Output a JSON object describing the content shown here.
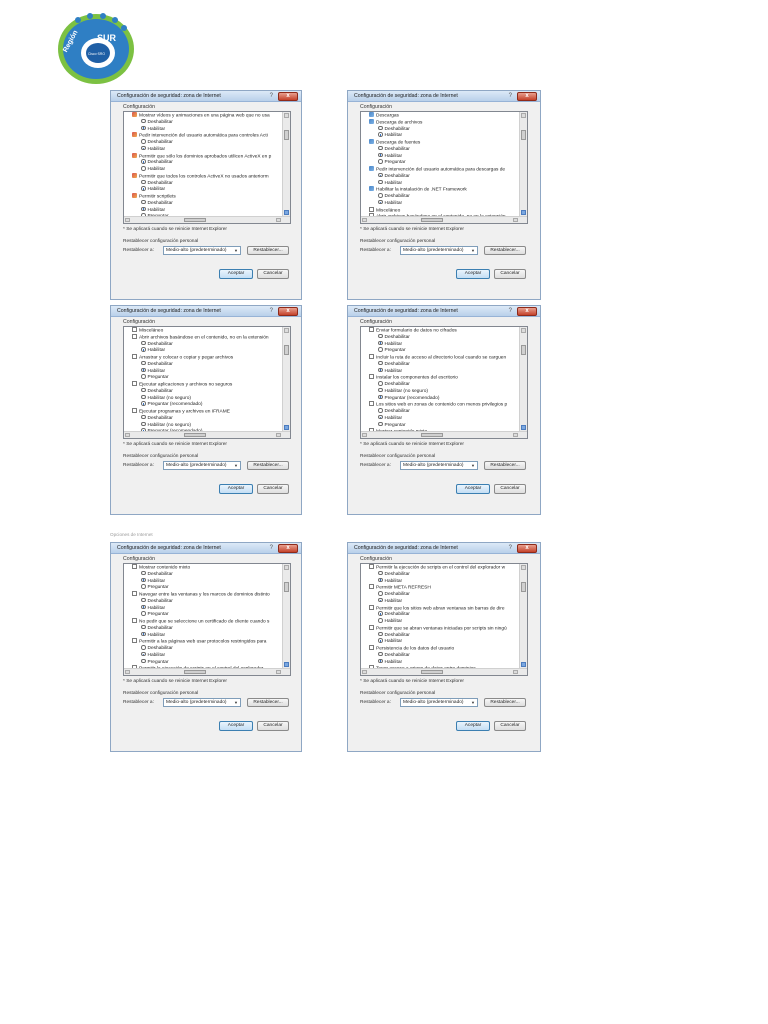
{
  "logo": {
    "text_region": "Región",
    "text_sur": "SUR",
    "text_cisco": "Cisco·SRO",
    "colors": {
      "ring": "#2f7fc4",
      "rim": "#7cc142",
      "center": "#ffffff",
      "inner": "#1f5fa5"
    }
  },
  "common": {
    "question": "?",
    "close": "x",
    "config_label": "Configuración",
    "note": "* Se aplicará cuando se reinicie Internet Explorer",
    "reset_label": "Restablecer configuración personal",
    "reset_to": "Restablecer a:",
    "reset_button": "Restablecer...",
    "ok": "Aceptar",
    "cancel": "Cancelar",
    "dropdown_arrow": "▼"
  },
  "ghost_caption": "Opciones de Internet",
  "dialogs": [
    {
      "title": "Configuración de seguridad: zona de Internet",
      "select": "Medio-alto (predeterminado)",
      "items": [
        {
          "kind": "sec",
          "level": "p",
          "text": "Mostrar vídeos y animaciones en una página web que no usa"
        },
        {
          "kind": "radio",
          "level": "s",
          "on": false,
          "text": "Deshabilitar"
        },
        {
          "kind": "radio",
          "level": "s",
          "on": true,
          "text": "Habilitar"
        },
        {
          "kind": "sec",
          "level": "p",
          "text": "Pedir intervención del usuario automática para controles Acti"
        },
        {
          "kind": "radio",
          "level": "s",
          "on": false,
          "text": "Deshabilitar"
        },
        {
          "kind": "radio",
          "level": "s",
          "on": true,
          "text": "Habilitar"
        },
        {
          "kind": "sec",
          "level": "p",
          "text": "Permitir que sólo los dominios aprobados utilicen ActiveX en p"
        },
        {
          "kind": "radio",
          "level": "s",
          "on": true,
          "text": "Deshabilitar"
        },
        {
          "kind": "radio",
          "level": "s",
          "on": false,
          "text": "Habilitar"
        },
        {
          "kind": "sec",
          "level": "p",
          "text": "Permitir que todos los controles ActiveX no usados anteriorm"
        },
        {
          "kind": "radio",
          "level": "s",
          "on": false,
          "text": "Deshabilitar"
        },
        {
          "kind": "radio",
          "level": "s",
          "on": true,
          "text": "Habilitar"
        },
        {
          "kind": "sec",
          "level": "p",
          "text": "Permitir scriptlets"
        },
        {
          "kind": "radio",
          "level": "s",
          "on": false,
          "text": "Deshabilitar"
        },
        {
          "kind": "radio",
          "level": "s",
          "on": true,
          "text": "Habilitar"
        },
        {
          "kind": "radio",
          "level": "s",
          "on": false,
          "text": "Preguntar"
        }
      ]
    },
    {
      "title": "Configuración de seguridad: zona de Internet",
      "select": "Medio-alto (predeterminado)",
      "items": [
        {
          "kind": "folder",
          "level": "p",
          "text": "Descargas"
        },
        {
          "kind": "folder",
          "level": "p",
          "text": "Descarga de archivos"
        },
        {
          "kind": "radio",
          "level": "s",
          "on": false,
          "text": "Deshabilitar"
        },
        {
          "kind": "radio",
          "level": "s",
          "on": true,
          "text": "Habilitar"
        },
        {
          "kind": "folder",
          "level": "p",
          "text": "Descarga de fuentes"
        },
        {
          "kind": "radio",
          "level": "s",
          "on": false,
          "text": "Deshabilitar"
        },
        {
          "kind": "radio",
          "level": "s",
          "on": true,
          "text": "Habilitar"
        },
        {
          "kind": "radio",
          "level": "s",
          "on": false,
          "text": "Preguntar"
        },
        {
          "kind": "folder",
          "level": "p",
          "text": "Pedir intervención del usuario automática para descargas de"
        },
        {
          "kind": "radio",
          "level": "s",
          "on": true,
          "text": "Deshabilitar"
        },
        {
          "kind": "radio",
          "level": "s",
          "on": false,
          "text": "Habilitar"
        },
        {
          "kind": "folder",
          "level": "p",
          "text": "Habilitar la instalación de .NET Framework"
        },
        {
          "kind": "radio",
          "level": "s",
          "on": false,
          "text": "Deshabilitar"
        },
        {
          "kind": "radio",
          "level": "s",
          "on": true,
          "text": "Habilitar"
        },
        {
          "kind": "box",
          "level": "p",
          "text": "Misceláneo"
        },
        {
          "kind": "box",
          "level": "p",
          "text": "Abrir archivos basándose en el contenido, no en la extensión"
        }
      ]
    },
    {
      "title": "Configuración de seguridad: zona de Internet",
      "select": "Medio-alto (predeterminado)",
      "items": [
        {
          "kind": "box",
          "level": "p",
          "text": "Misceláneo"
        },
        {
          "kind": "box",
          "level": "p",
          "text": "Abrir archivos basándose en el contenido, no en la extensión"
        },
        {
          "kind": "radio",
          "level": "s",
          "on": false,
          "text": "Deshabilitar"
        },
        {
          "kind": "radio",
          "level": "s",
          "on": true,
          "text": "Habilitar"
        },
        {
          "kind": "box",
          "level": "p",
          "text": "Arrastrar y colocar o copiar y pegar archivos"
        },
        {
          "kind": "radio",
          "level": "s",
          "on": false,
          "text": "Deshabilitar"
        },
        {
          "kind": "radio",
          "level": "s",
          "on": true,
          "text": "Habilitar"
        },
        {
          "kind": "radio",
          "level": "s",
          "on": false,
          "text": "Preguntar"
        },
        {
          "kind": "box",
          "level": "p",
          "text": "Ejecutar aplicaciones y archivos no seguros"
        },
        {
          "kind": "radio",
          "level": "s",
          "on": false,
          "text": "Deshabilitar"
        },
        {
          "kind": "radio",
          "level": "s",
          "on": false,
          "text": "Habilitar (no seguro)"
        },
        {
          "kind": "radio",
          "level": "s",
          "on": true,
          "text": "Preguntar (recomendado)"
        },
        {
          "kind": "box",
          "level": "p",
          "text": "Ejecutar programas y archivos en IFRAME"
        },
        {
          "kind": "radio",
          "level": "s",
          "on": false,
          "text": "Deshabilitar"
        },
        {
          "kind": "radio",
          "level": "s",
          "on": false,
          "text": "Habilitar (no seguro)"
        },
        {
          "kind": "radio",
          "level": "s",
          "on": true,
          "text": "Preguntar (recomendado)"
        }
      ]
    },
    {
      "title": "Configuración de seguridad: zona de Internet",
      "select": "Medio-alto (predeterminado)",
      "items": [
        {
          "kind": "box",
          "level": "p",
          "text": "Enviar formulario de datos no cifrados"
        },
        {
          "kind": "radio",
          "level": "s",
          "on": false,
          "text": "Deshabilitar"
        },
        {
          "kind": "radio",
          "level": "s",
          "on": true,
          "text": "Habilitar"
        },
        {
          "kind": "radio",
          "level": "s",
          "on": false,
          "text": "Preguntar"
        },
        {
          "kind": "box",
          "level": "p",
          "text": "Incluir la ruta de acceso al directorio local cuando se carguen"
        },
        {
          "kind": "radio",
          "level": "s",
          "on": false,
          "text": "Deshabilitar"
        },
        {
          "kind": "radio",
          "level": "s",
          "on": true,
          "text": "Habilitar"
        },
        {
          "kind": "box",
          "level": "p",
          "text": "Instalar los componentes del escritorio"
        },
        {
          "kind": "radio",
          "level": "s",
          "on": false,
          "text": "Deshabilitar"
        },
        {
          "kind": "radio",
          "level": "s",
          "on": false,
          "text": "Habilitar (no seguro)"
        },
        {
          "kind": "radio",
          "level": "s",
          "on": true,
          "text": "Preguntar (recomendado)"
        },
        {
          "kind": "box",
          "level": "p",
          "text": "Los sitios web en zonas de contenido con menos privilegios p"
        },
        {
          "kind": "radio",
          "level": "s",
          "on": false,
          "text": "Deshabilitar"
        },
        {
          "kind": "radio",
          "level": "s",
          "on": true,
          "text": "Habilitar"
        },
        {
          "kind": "radio",
          "level": "s",
          "on": false,
          "text": "Preguntar"
        },
        {
          "kind": "box",
          "level": "p",
          "text": "Mostrar contenido mixto"
        }
      ]
    },
    {
      "title": "Configuración de seguridad: zona de Internet",
      "select": "Medio-alto (predeterminado)",
      "items": [
        {
          "kind": "box",
          "level": "p",
          "text": "Mostrar contenido mixto"
        },
        {
          "kind": "radio",
          "level": "s",
          "on": false,
          "text": "Deshabilitar"
        },
        {
          "kind": "radio",
          "level": "s",
          "on": true,
          "text": "Habilitar"
        },
        {
          "kind": "radio",
          "level": "s",
          "on": false,
          "text": "Preguntar"
        },
        {
          "kind": "box",
          "level": "p",
          "text": "Navegar entre las ventanas y los marcos de dominios distinto"
        },
        {
          "kind": "radio",
          "level": "s",
          "on": false,
          "text": "Deshabilitar"
        },
        {
          "kind": "radio",
          "level": "s",
          "on": true,
          "text": "Habilitar"
        },
        {
          "kind": "radio",
          "level": "s",
          "on": false,
          "text": "Preguntar"
        },
        {
          "kind": "box",
          "level": "p",
          "text": "No pedir que se seleccione un certificado de cliente cuando s"
        },
        {
          "kind": "radio",
          "level": "s",
          "on": false,
          "text": "Deshabilitar"
        },
        {
          "kind": "radio",
          "level": "s",
          "on": true,
          "text": "Habilitar"
        },
        {
          "kind": "box",
          "level": "p",
          "text": "Permitir a las páginas web usar protocolos restringidos para"
        },
        {
          "kind": "radio",
          "level": "s",
          "on": false,
          "text": "Deshabilitar"
        },
        {
          "kind": "radio",
          "level": "s",
          "on": true,
          "text": "Habilitar"
        },
        {
          "kind": "radio",
          "level": "s",
          "on": false,
          "text": "Preguntar"
        },
        {
          "kind": "box",
          "level": "p",
          "text": "Permitir la ejecución de scripts en el control del explorador"
        }
      ]
    },
    {
      "title": "Configuración de seguridad: zona de Internet",
      "select": "Medio-alto (predeterminado)",
      "items": [
        {
          "kind": "box",
          "level": "p",
          "text": "Permitir la ejecución de scripts en el control del explorador w"
        },
        {
          "kind": "radio",
          "level": "s",
          "on": false,
          "text": "Deshabilitar"
        },
        {
          "kind": "radio",
          "level": "s",
          "on": true,
          "text": "Habilitar"
        },
        {
          "kind": "box",
          "level": "p",
          "text": "Permitir META REFRESH"
        },
        {
          "kind": "radio",
          "level": "s",
          "on": false,
          "text": "Deshabilitar"
        },
        {
          "kind": "radio",
          "level": "s",
          "on": true,
          "text": "Habilitar"
        },
        {
          "kind": "box",
          "level": "p",
          "text": "Permitir que los sitios web abran ventanas sin barras de dire"
        },
        {
          "kind": "radio",
          "level": "s",
          "on": true,
          "text": "Deshabilitar"
        },
        {
          "kind": "radio",
          "level": "s",
          "on": false,
          "text": "Habilitar"
        },
        {
          "kind": "box",
          "level": "p",
          "text": "Permitir que se abran ventanas iniciadas por scripts sin ningú"
        },
        {
          "kind": "radio",
          "level": "s",
          "on": false,
          "text": "Deshabilitar"
        },
        {
          "kind": "radio",
          "level": "s",
          "on": true,
          "text": "Habilitar"
        },
        {
          "kind": "box",
          "level": "p",
          "text": "Persistencia de los datos del usuario"
        },
        {
          "kind": "radio",
          "level": "s",
          "on": false,
          "text": "Deshabilitar"
        },
        {
          "kind": "radio",
          "level": "s",
          "on": true,
          "text": "Habilitar"
        },
        {
          "kind": "box",
          "level": "p",
          "text": "Tener acceso a origen de datos entre dominios"
        }
      ]
    }
  ]
}
